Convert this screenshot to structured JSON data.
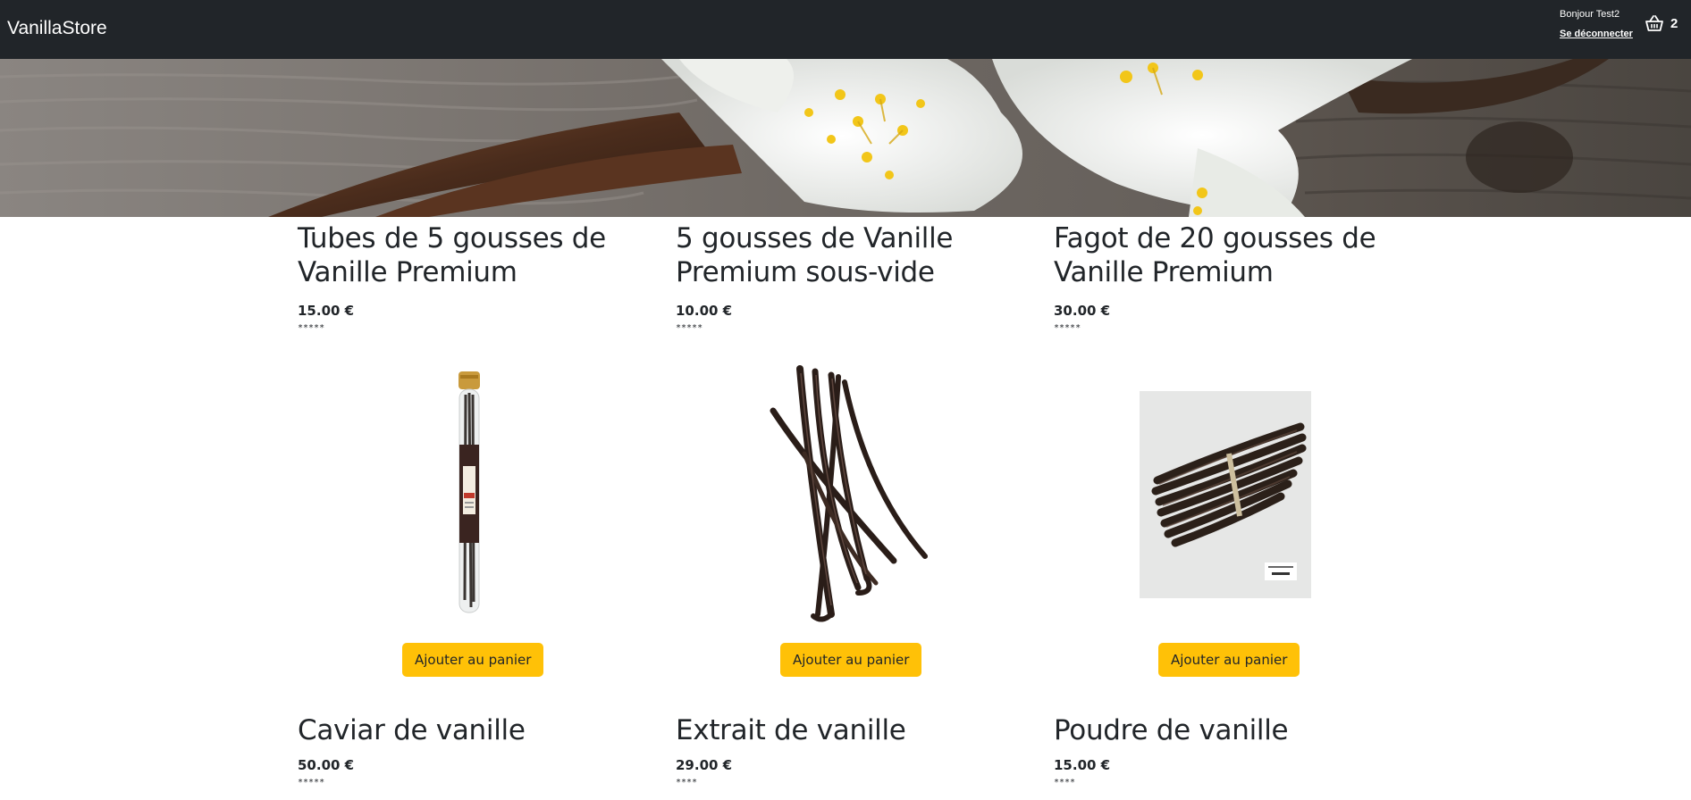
{
  "navbar": {
    "brand": "VanillaStore",
    "greeting": "Bonjour Test2",
    "logout_label": "Se déconnecter",
    "cart_count": "2",
    "cart_icon": "basket-icon",
    "background": "#212529"
  },
  "hero": {
    "image": "vanilla-flowers-banner"
  },
  "products": [
    {
      "title": "Tubes de 5 gousses de Vanille Premium",
      "price": "15.00 €",
      "rating": "*****",
      "image": "vanilla-tube-image",
      "button_label": "Ajouter au panier"
    },
    {
      "title": "5 gousses de Vanille Premium sous-vide",
      "price": "10.00 €",
      "rating": "*****",
      "image": "vanilla-pods-image",
      "button_label": "Ajouter au panier"
    },
    {
      "title": "Fagot de 20 gousses de Vanille Premium",
      "price": "30.00 €",
      "rating": "*****",
      "image": "vanilla-bundle-image",
      "button_label": "Ajouter au panier"
    },
    {
      "title": "Caviar de vanille",
      "price": "50.00 €",
      "rating": "*****"
    },
    {
      "title": "Extrait de vanille",
      "price": "29.00 €",
      "rating": "****"
    },
    {
      "title": "Poudre de vanille",
      "price": "15.00 €",
      "rating": "****"
    }
  ],
  "colors": {
    "accent": "#ffc107",
    "text": "#212529"
  }
}
